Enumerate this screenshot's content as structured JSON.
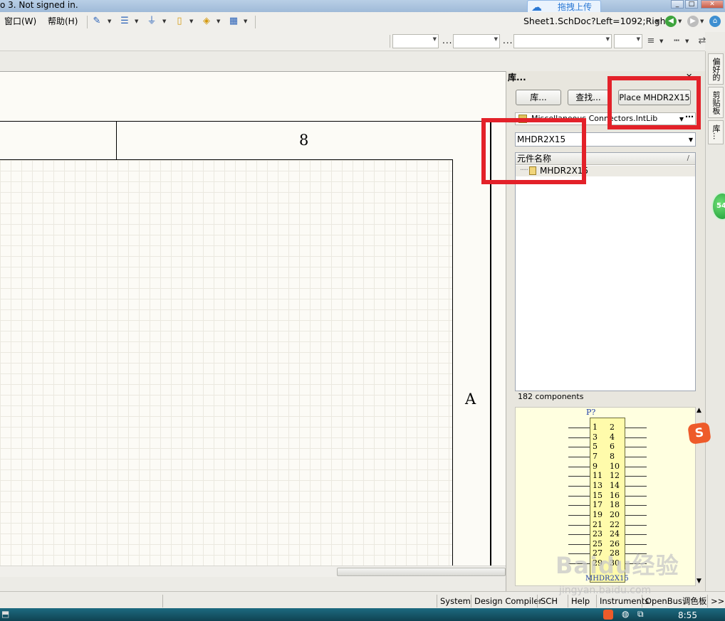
{
  "titlebar": {
    "title": "o 3. Not signed in.",
    "upload_label": "拖拽上传"
  },
  "menu": {
    "window": "窗口(W)",
    "help": "帮助(H)"
  },
  "address": {
    "text": "Sheet1.SchDoc?Left=1092;Right"
  },
  "schematic": {
    "zone_column": "8",
    "zone_row": "A"
  },
  "library_panel": {
    "title": "库...",
    "libraries_button": "库...",
    "search_button": "查找...",
    "place_button": "Place MHDR2X15",
    "library_name": "Miscellaneous Connectors.IntLib",
    "filter_value": "MHDR2X15",
    "column_header": "元件名称",
    "results": [
      "MHDR2X15"
    ],
    "count_text": "182 components",
    "preview": {
      "designator": "P?",
      "footer_name": "MHDR2X15",
      "pins_left": [
        "1",
        "3",
        "5",
        "7",
        "9",
        "11",
        "13",
        "15",
        "17",
        "19",
        "21",
        "23",
        "25",
        "27",
        "29"
      ],
      "pins_right": [
        "2",
        "4",
        "6",
        "8",
        "10",
        "12",
        "14",
        "16",
        "18",
        "20",
        "22",
        "24",
        "26",
        "28",
        "30"
      ]
    }
  },
  "side_tabs": [
    "偏好的",
    "剪贴板",
    "库..."
  ],
  "float_badge": "54",
  "statusbar": {
    "items": [
      "System",
      "Design Compiler",
      "SCH",
      "Help",
      "Instruments",
      "OpenBus调色板",
      ">>"
    ]
  },
  "taskbar": {
    "clock": "8:55"
  },
  "watermark": {
    "brand": "Baidu经验",
    "url": "jingyan.baidu.com"
  }
}
